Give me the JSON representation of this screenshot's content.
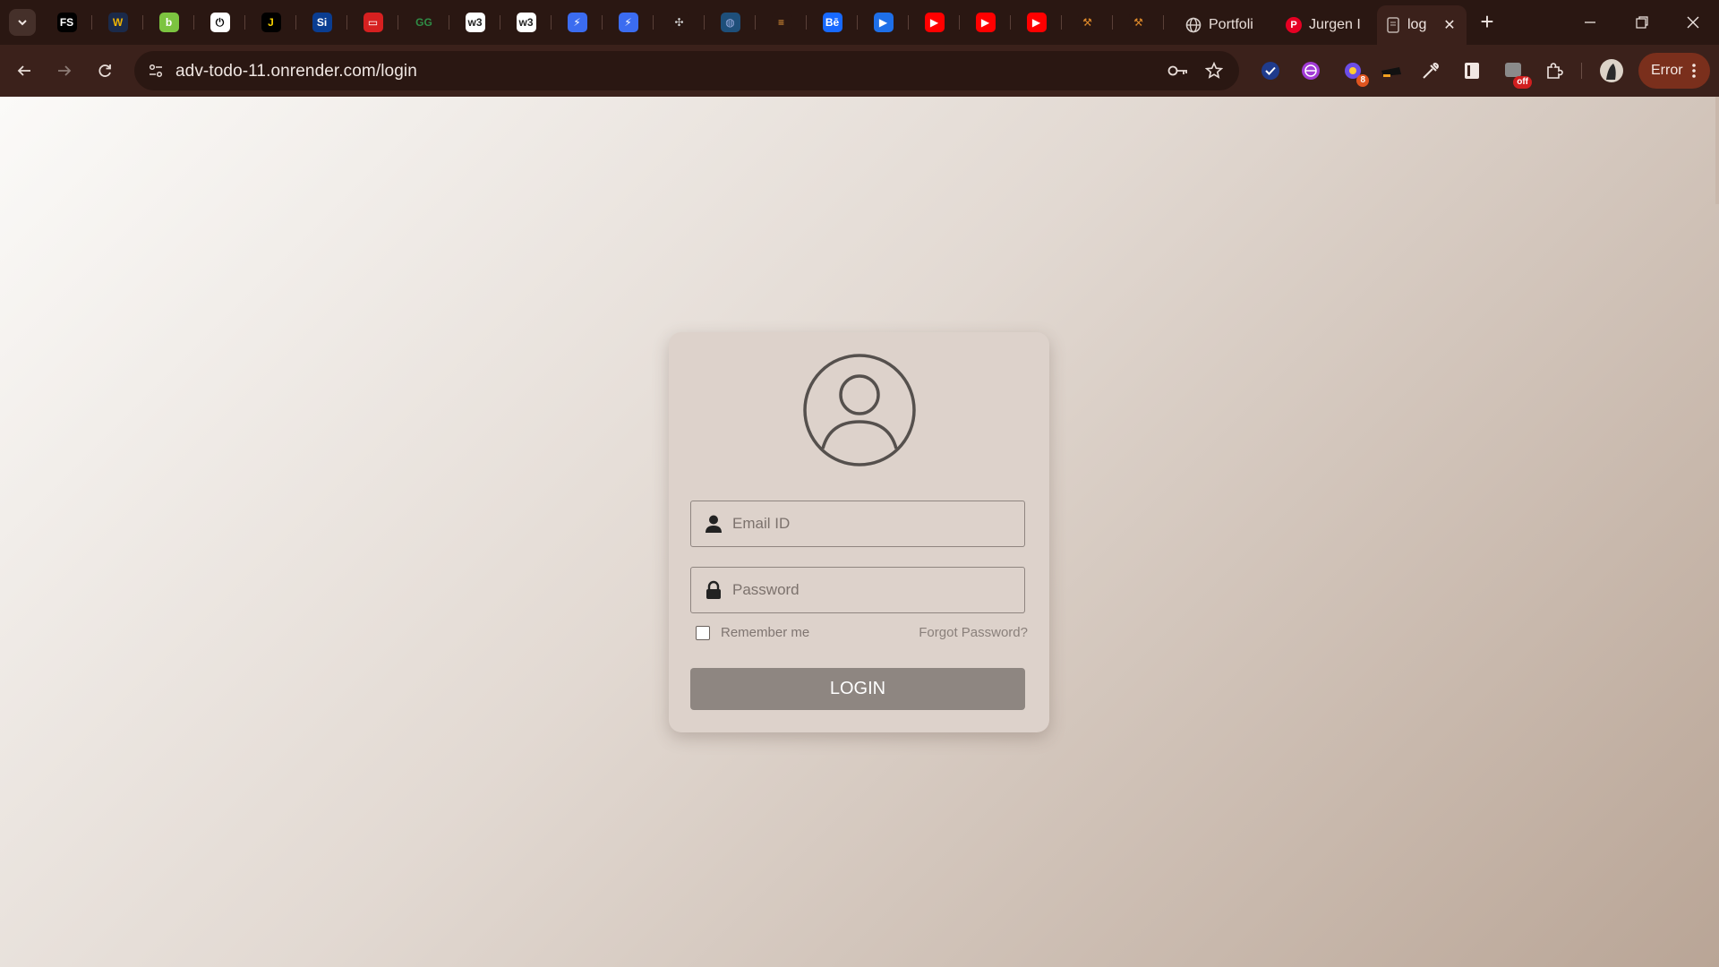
{
  "browser": {
    "pinned_tabs": [
      {
        "icon": "fs-icon",
        "text": "FS",
        "bg": "#000000",
        "fg": "#ffffff"
      },
      {
        "icon": "webflow-w-icon",
        "text": "W",
        "bg": "#1b2a4a",
        "fg": "#f0b400"
      },
      {
        "icon": "green-circle-icon",
        "text": "b",
        "bg": "#7cc440",
        "fg": "#ffffff"
      },
      {
        "icon": "power-circle-icon",
        "text": "⏻",
        "bg": "#ffffff",
        "fg": "#000000"
      },
      {
        "icon": "j-icon",
        "text": "J",
        "bg": "#000000",
        "fg": "#f5d000"
      },
      {
        "icon": "si-icon",
        "text": "Si",
        "bg": "#0a3d91",
        "fg": "#ffffff"
      },
      {
        "icon": "red-pill-icon",
        "text": "▭",
        "bg": "#d62020",
        "fg": "#ffffff"
      },
      {
        "icon": "geeksforgeeks-icon",
        "text": "GG",
        "bg": "#2a1712",
        "fg": "#2f8d46"
      },
      {
        "icon": "w3schools-icon",
        "text": "w3",
        "bg": "#ffffff",
        "fg": "#222222"
      },
      {
        "icon": "w3schools-icon",
        "text": "w3",
        "bg": "#ffffff",
        "fg": "#222222"
      },
      {
        "icon": "blue-bolt-icon",
        "text": "⚡",
        "bg": "#3b6cf0",
        "fg": "#ffffff"
      },
      {
        "icon": "blue-bolt-icon",
        "text": "⚡",
        "bg": "#3b6cf0",
        "fg": "#ffffff"
      },
      {
        "icon": "network-icon",
        "text": "✣",
        "bg": "#2a1712",
        "fg": "#cccccc"
      },
      {
        "icon": "globe-striped-icon",
        "text": "◍",
        "bg": "#1e4f7a",
        "fg": "#9ad"
      },
      {
        "icon": "stack-icon",
        "text": "≡",
        "bg": "#2a1712",
        "fg": "#f2a03a"
      },
      {
        "icon": "behance-icon",
        "text": "Bē",
        "bg": "#1769ff",
        "fg": "#ffffff"
      },
      {
        "icon": "play-blue-icon",
        "text": "▶",
        "bg": "#1e6fe8",
        "fg": "#ffffff"
      },
      {
        "icon": "youtube-icon",
        "text": "▶",
        "bg": "#ff0000",
        "fg": "#ffffff"
      },
      {
        "icon": "youtube-icon",
        "text": "▶",
        "bg": "#ff0000",
        "fg": "#ffffff"
      },
      {
        "icon": "youtube-icon",
        "text": "▶",
        "bg": "#ff0000",
        "fg": "#ffffff"
      },
      {
        "icon": "tools-icon",
        "text": "⚒",
        "bg": "#2a1712",
        "fg": "#e08a2a"
      },
      {
        "icon": "tools-icon",
        "text": "⚒",
        "bg": "#2a1712",
        "fg": "#e08a2a"
      }
    ],
    "tabs": [
      {
        "title": "Portfoli",
        "icon": "globe-icon"
      },
      {
        "title": "Jurgen I",
        "icon": "pinterest-icon"
      }
    ],
    "active_tab": {
      "title": "log",
      "icon": "page-icon"
    },
    "url": "adv-todo-11.onrender.com/login",
    "profile_status": "Error",
    "extension_badge": "8",
    "extension_off_label": "off"
  },
  "login": {
    "email_placeholder": "Email ID",
    "password_placeholder": "Password",
    "remember_label": "Remember me",
    "forgot_label": "Forgot Password?",
    "button_label": "LOGIN"
  }
}
